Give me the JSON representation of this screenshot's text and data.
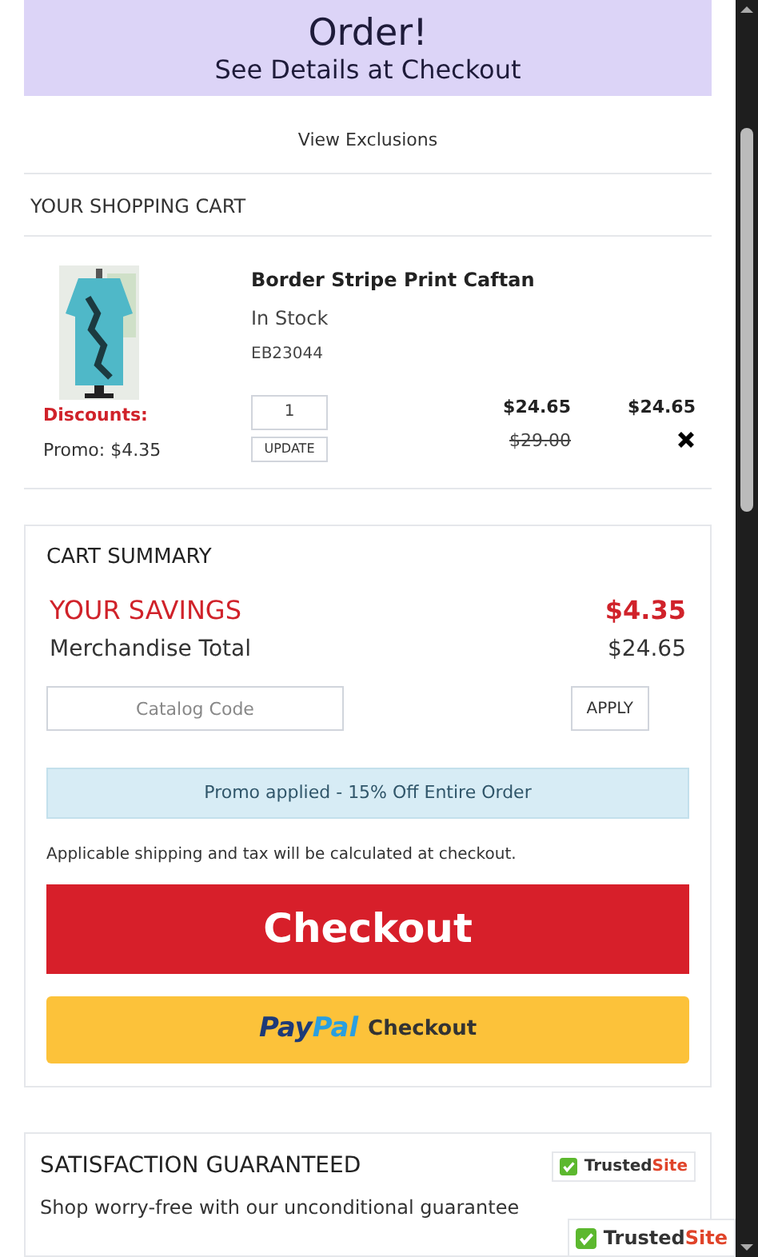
{
  "banner": {
    "headline": "Order!",
    "subline": "See Details at Checkout"
  },
  "exclusions_link": "View Exclusions",
  "cart": {
    "title": "YOUR SHOPPING CART",
    "items": [
      {
        "kind": "picture",
        "name": "Border Stripe Print Caftan",
        "stock": "In Stock",
        "sku": "EB23044",
        "discounts_label": "Discounts:",
        "promo": "Promo: $4.35",
        "quantity": "1",
        "update": "UPDATE",
        "price": "$24.65",
        "original_price": "$29.00",
        "total": "$24.65"
      }
    ]
  },
  "summary": {
    "title": "CART SUMMARY",
    "savings_label": "YOUR SAVINGS",
    "savings": "$4.35",
    "merch_label": "Merchandise Total",
    "merch": "$24.65",
    "code_placeholder": "Catalog Code",
    "apply": "APPLY",
    "promo_notice": "Promo applied - 15% Off Entire Order",
    "shipping_note": "Applicable shipping and tax will be calculated at checkout.",
    "checkout": "Checkout",
    "paypal": {
      "pay": "Pay",
      "pal": "Pal",
      "label": "Checkout"
    }
  },
  "guarantee": {
    "title": "SATISFACTION GUARANTEED",
    "text": "Shop worry-free with our unconditional guarantee",
    "badges": [
      {
        "trusted": "Trusted",
        "site": "Site"
      },
      {
        "trusted": "Trusted",
        "site": "Site"
      }
    ]
  }
}
